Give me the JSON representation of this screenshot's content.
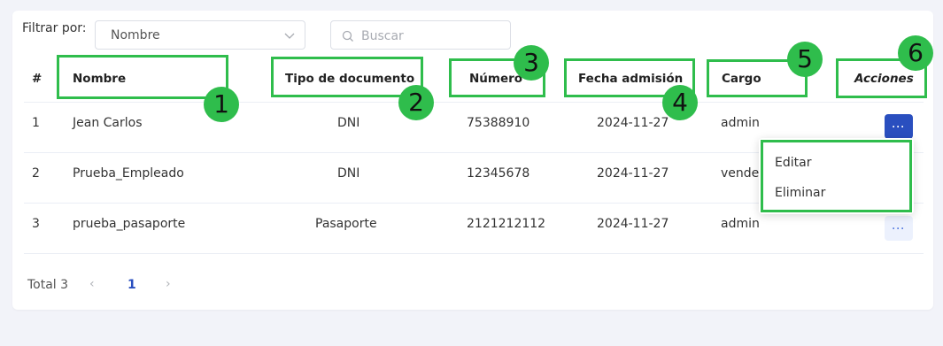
{
  "filter": {
    "label": "Filtrar por:",
    "select_value": "Nombre",
    "search_placeholder": "Buscar"
  },
  "table": {
    "headers": {
      "index": "#",
      "nombre": "Nombre",
      "tipo": "Tipo de documento",
      "numero": "Número",
      "fecha": "Fecha admisión",
      "cargo": "Cargo",
      "acciones": "Acciones"
    },
    "rows": [
      {
        "index": "1",
        "nombre": "Jean Carlos",
        "tipo": "DNI",
        "numero": "75388910",
        "fecha": "2024-11-27",
        "cargo": "admin"
      },
      {
        "index": "2",
        "nombre": "Prueba_Empleado",
        "tipo": "DNI",
        "numero": "12345678",
        "fecha": "2024-11-27",
        "cargo": "vende"
      },
      {
        "index": "3",
        "nombre": "prueba_pasaporte",
        "tipo": "Pasaporte",
        "numero": "2121212112",
        "fecha": "2024-11-27",
        "cargo": "admin"
      }
    ],
    "actions_glyph": "···"
  },
  "dropdown_menu": {
    "edit": "Editar",
    "delete": "Eliminar"
  },
  "annotations": [
    "1",
    "2",
    "3",
    "4",
    "5",
    "6"
  ],
  "pagination": {
    "total": "Total 3",
    "current_page": "1",
    "prev_glyph": "‹",
    "next_glyph": "›"
  },
  "colors": {
    "highlight": "#2fbd4c",
    "primary": "#2a4fbf",
    "background": "#f2f3f9"
  }
}
